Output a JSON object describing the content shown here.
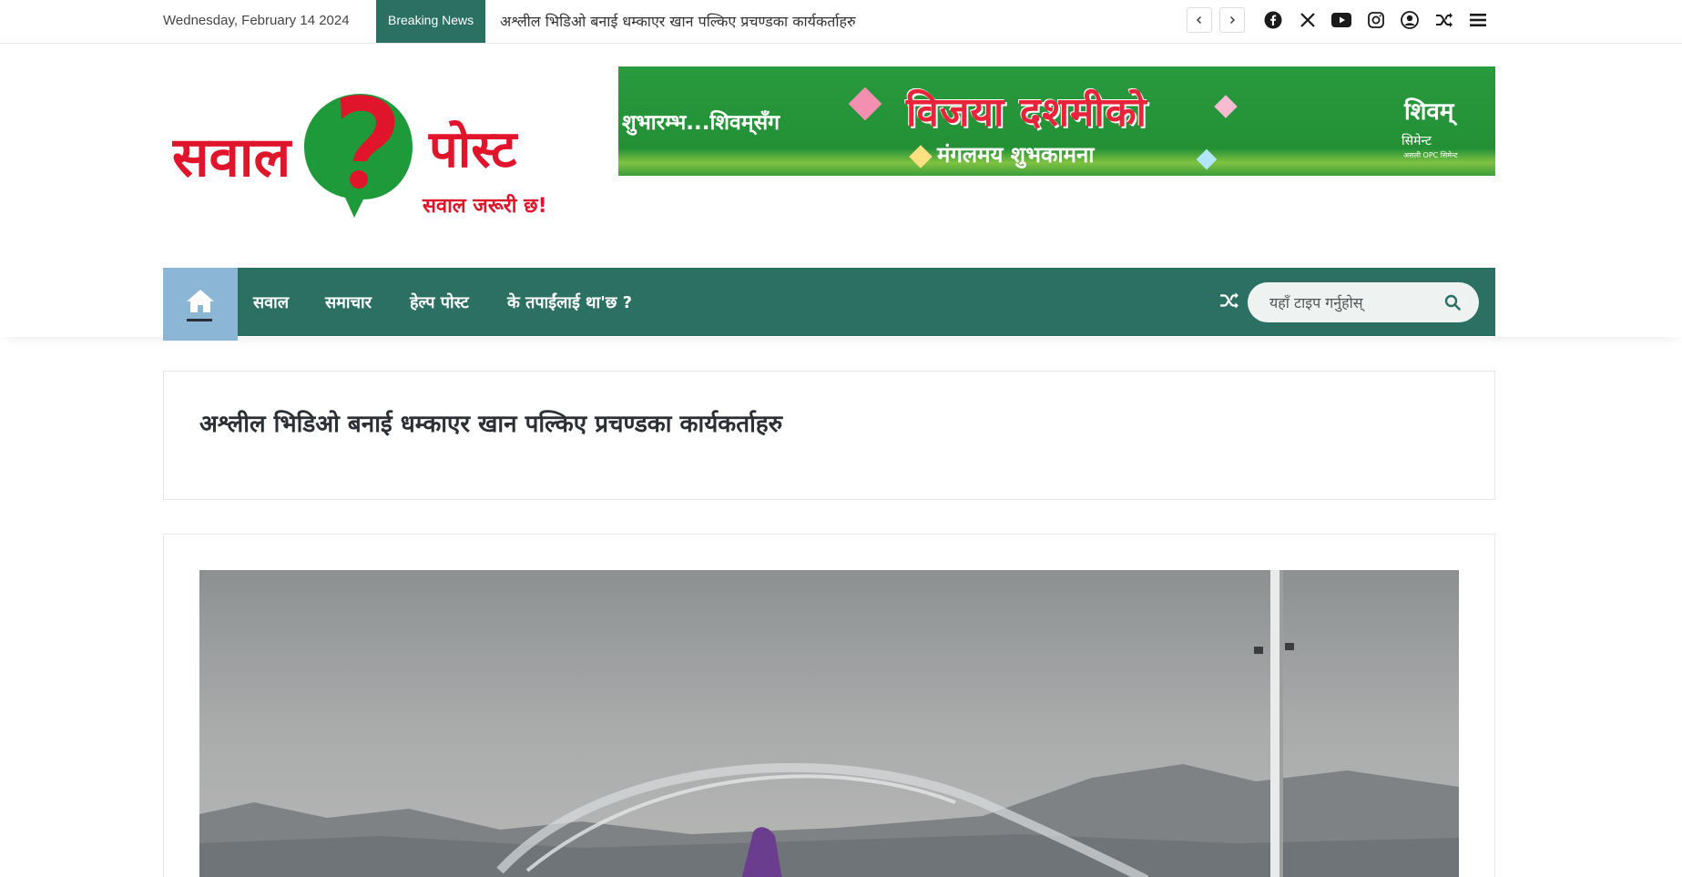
{
  "topbar": {
    "date": "Wednesday, February 14 2024",
    "breaking_label": "Breaking News",
    "breaking_headline": "अश्लील भिडिओ बनाई धम्काएर खान पल्किए प्रचण्डका कार्यकर्ताहरु",
    "prev_icon": "chevron-left-icon",
    "next_icon": "chevron-right-icon",
    "social_icons": [
      "facebook-icon",
      "x-icon",
      "youtube-icon",
      "instagram-icon",
      "user-icon",
      "shuffle-icon",
      "menu-icon"
    ]
  },
  "header": {
    "logo": {
      "word1": "सवाल",
      "word2": "पोस्ट",
      "mark": "?",
      "tagline": "सवाल जरूरी छ!"
    },
    "banner": {
      "left_text": "शुभारम्भ...शिवम्‌सँग",
      "title": "विजया दशमीको",
      "subtitle": "मंगलमय शुभकामना",
      "brand": "शिवम्",
      "brand_sub": "सिमेन्ट",
      "brand_tag": "असली OPC सिमेन्ट"
    }
  },
  "nav": {
    "home_icon": "home-icon",
    "items": [
      "सवाल",
      "समाचार",
      "हेल्प पोस्ट",
      "के तपाईंलाई था'छ ?"
    ],
    "shuffle_icon": "shuffle-icon",
    "search_placeholder": "यहाँ टाइप गर्नुहोस्",
    "search_icon": "search-icon"
  },
  "article": {
    "title": "अश्लील भिडिओ बनाई धम्काएर खान पल्किए प्रचण्डका कार्यकर्ताहरु"
  },
  "colors": {
    "brand_green": "#2b7063",
    "home_active": "#8cb6d5",
    "logo_red": "#e0142b",
    "logo_green": "#1f9a3a"
  }
}
